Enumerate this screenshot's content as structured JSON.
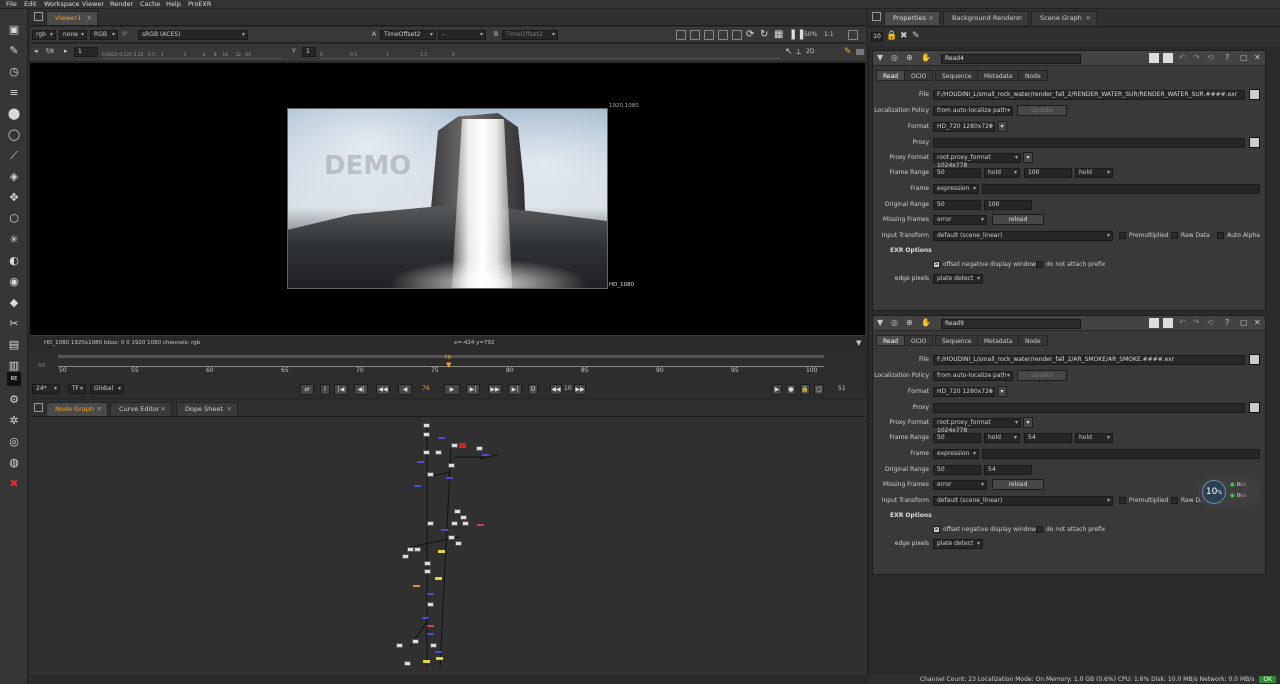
{
  "menu": [
    "File",
    "Edit",
    "Workspace",
    "Viewer",
    "Render",
    "Cache",
    "Help",
    "ProEXR"
  ],
  "viewer_panel": {
    "tab": "Viewer1",
    "channels": "rgb",
    "alpha": "none",
    "display": "RGB",
    "ip_label": "IP",
    "colorspace": "sRGB (ACES)",
    "input_a_label": "A",
    "input_a": "TimeOffset2",
    "input_a_op": "-",
    "input_b_label": "B",
    "input_b": "TimeOffset2",
    "zoom": "50%",
    "ratio": "1:1",
    "view_mode": "2D",
    "fstop": "f/8",
    "frame_field": "1",
    "y_label": "Y",
    "y_field": "1",
    "gain_ticks": [
      "0.0625",
      "0.125",
      "0.25",
      "0.5",
      "1",
      "2",
      "4",
      "8",
      "16",
      "32",
      "64"
    ],
    "gamma_ticks": [
      "0",
      "0.5",
      "1",
      "1.5",
      "2"
    ],
    "res_label_tr": "1920,1080",
    "res_label_br": "HD_1080",
    "watermark": "DEMO",
    "info_left": "HD_1080 1920x1080  bbox: 0 0 1920 1080 channels: rgb",
    "info_coords": "x=-424 y=792"
  },
  "timeline": {
    "start": "50",
    "labels": [
      "50",
      "55",
      "60",
      "65",
      "70",
      "75",
      "80",
      "85",
      "90",
      "95",
      "100"
    ],
    "current_frame": "76",
    "fps": "24*",
    "tf": "TF",
    "global": "Global",
    "frame_display": "76",
    "step": "10",
    "end_frame": "51"
  },
  "node_graph": {
    "tabs": [
      "Node Graph",
      "Curve Editor",
      "Dope Sheet"
    ]
  },
  "properties": {
    "tabs": [
      "Properties",
      "Background Renders",
      "Scene Graph"
    ],
    "max_panels": "10",
    "panels": [
      {
        "name": "Read4",
        "subtabs": [
          "Read",
          "OCIO",
          "Sequence",
          "Metadata",
          "Node"
        ],
        "file": "F:/HOUDINI_L/small_rock_water/render_fall_2/RENDER_WATER_SUR/RENDER_WATER_SUR.####.exr",
        "localization_policy": "from auto-localize path",
        "update_label": "Update",
        "format": "HD_720 1280x720",
        "proxy": "",
        "proxy_format": "root.proxy_format 1024x778",
        "frame_range_start": "50",
        "frame_range_start_mode": "hold",
        "frame_range_end": "100",
        "frame_range_end_mode": "hold",
        "frame": "expression",
        "original_range_start": "50",
        "original_range_end": "100",
        "missing_frames": "error",
        "reload_label": "reload",
        "input_transform": "default (scene_linear)",
        "premultiplied": "Premultiplied",
        "raw_data": "Raw Data",
        "auto_alpha": "Auto Alpha",
        "exr_options": "EXR Options",
        "offset_negative": "offset negative display window",
        "do_not_attach": "do not attach prefix",
        "edge_pixels": "plate detect"
      },
      {
        "name": "Read9",
        "subtabs": [
          "Read",
          "OCIO",
          "Sequence",
          "Metadata",
          "Node"
        ],
        "file": "F:/HOUDINI_L/small_rock_water/render_fall_2/AR_SMOKE/AR_SMOKE.####.exr",
        "localization_policy": "from auto-localize path",
        "update_label": "Update",
        "format": "HD_720 1280x720",
        "proxy": "",
        "proxy_format": "root.proxy_format 1024x778",
        "frame_range_start": "50",
        "frame_range_start_mode": "hold",
        "frame_range_end": "54",
        "frame_range_end_mode": "hold",
        "frame": "expression",
        "original_range_start": "50",
        "original_range_end": "54",
        "missing_frames": "error",
        "reload_label": "reload",
        "input_transform": "default (scene_linear)",
        "premultiplied": "Premultiplied",
        "raw_data": "Raw Da",
        "auto_alpha": "",
        "exr_options": "EXR Options",
        "offset_negative": "offset negative display window",
        "do_not_attach": "do not attach prefix",
        "edge_pixels": "plate detect"
      }
    ],
    "field_labels": {
      "file": "File",
      "localization": "Localization Policy",
      "format": "Format",
      "proxy": "Proxy",
      "proxy_format": "Proxy Format",
      "frame_range": "Frame Range",
      "frame": "Frame",
      "original_range": "Original Range",
      "missing_frames": "Missing Frames",
      "input_transform": "Input Transform",
      "edge_pixels": "edge pixels"
    }
  },
  "perf_widget": {
    "value": "10",
    "unit": "%",
    "rate1": "0",
    "rate1_unit": "K/s",
    "rate2": "0",
    "rate2_unit": "K/s"
  },
  "status_bar": "Channel Count: 23  Localization Mode: On  Memory: 1.0 GB (0.6%)  CPU: 1.6%  Disk: 10.0 MB/s  Network: 0.0 MB/s",
  "status_ok": "OK",
  "colors": {
    "accent": "#f0a033",
    "node_blue": "#4a4fd0",
    "node_yellow": "#e6d53a",
    "ok_green": "#2e8b2e"
  }
}
